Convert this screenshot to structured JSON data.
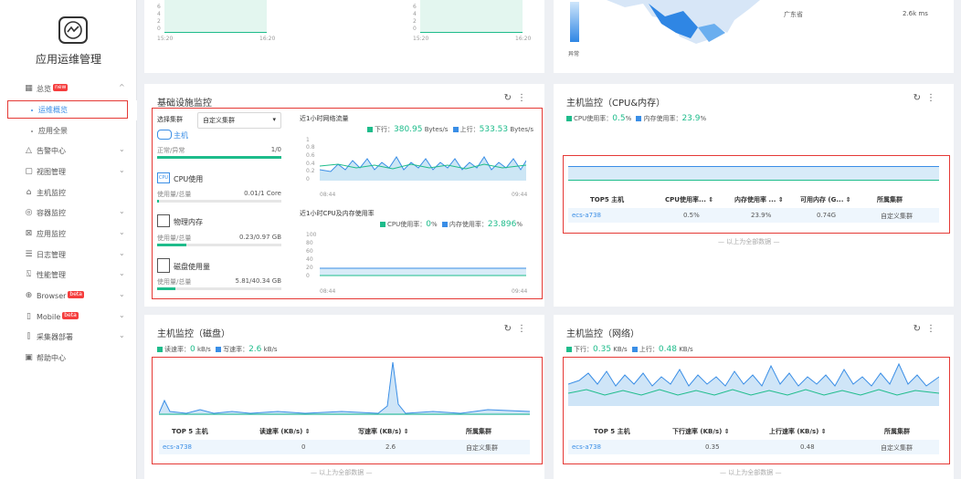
{
  "sidebar": {
    "app_title": "应用运维管理",
    "items": [
      {
        "label": "总览",
        "badge": "new",
        "icon": "grid-icon",
        "chevron": "^"
      },
      {
        "label": "运维概览",
        "sub": true,
        "active": true
      },
      {
        "label": "应用全景",
        "sub": true
      },
      {
        "label": "告警中心",
        "icon": "bell-icon",
        "chevron": "v"
      },
      {
        "label": "视图管理",
        "icon": "window-icon",
        "chevron": "v"
      },
      {
        "label": "主机监控",
        "icon": "host-icon"
      },
      {
        "label": "容器监控",
        "icon": "container-icon",
        "chevron": "v"
      },
      {
        "label": "应用监控",
        "icon": "app-monitor-icon",
        "chevron": "v"
      },
      {
        "label": "日志管理",
        "icon": "log-icon",
        "chevron": "v"
      },
      {
        "label": "性能管理",
        "icon": "performance-icon",
        "chevron": "v"
      },
      {
        "label": "Browser",
        "badge": "beta",
        "icon": "globe-icon",
        "chevron": "v"
      },
      {
        "label": "Mobile",
        "badge": "beta",
        "icon": "mobile-icon",
        "chevron": "v"
      },
      {
        "label": "采集器部署",
        "icon": "collector-icon",
        "chevron": "v"
      },
      {
        "label": "帮助中心",
        "icon": "help-icon"
      }
    ]
  },
  "top_cards": {
    "left": {
      "ticks": [
        "6",
        "4",
        "2",
        "0"
      ],
      "x_start": "15:20",
      "x_end": "16:20"
    },
    "mid": {
      "ticks": [
        "6",
        "4",
        "2",
        "0"
      ],
      "x_start": "15:20",
      "x_end": "16:20"
    },
    "right": {
      "region": "广东省",
      "value": "2.6k ms",
      "legend_low": "异常"
    }
  },
  "infra": {
    "title": "基础设施监控",
    "refresh_icon": "refresh-icon",
    "more_icon": "more-icon",
    "select_label": "选择集群",
    "select_value": "自定义集群",
    "host": {
      "name": "主机",
      "sub": "正常/异常",
      "value_a": "1",
      "value_b": "/0",
      "fill": 1.0
    },
    "cpu": {
      "name": "CPU使用",
      "sub": "使用量/总量",
      "value_a": "0.01",
      "value_b": "/1 Core",
      "fill": 0.01
    },
    "mem": {
      "name": "物理内存",
      "sub": "使用量/总量",
      "value_a": "0.23",
      "value_b": "/0.97 GB",
      "fill": 0.237
    },
    "disk": {
      "name": "磁盘使用量",
      "sub": "使用量/总量",
      "value_a": "5.81",
      "value_b": "/40.34 GB",
      "fill": 0.144
    },
    "net_chart": {
      "title": "近1小时网络流量",
      "down_label": "下行：",
      "down_value": "380.95",
      "down_unit": "Bytes/s",
      "up_label": "上行：",
      "up_value": "533.53",
      "up_unit": "Bytes/s",
      "ticks": [
        "1",
        "0.8",
        "0.6",
        "0.4",
        "0.2",
        "0"
      ],
      "x_start": "08:44",
      "x_end": "09:44"
    },
    "cpu_chart": {
      "title": "近1小时CPU及内存使用率",
      "cpu_label": "CPU使用率：",
      "cpu_value": "0",
      "cpu_unit": "%",
      "mem_label": "内存使用率：",
      "mem_value": "23.896",
      "mem_unit": "%",
      "ticks": [
        "100",
        "80",
        "60",
        "40",
        "20",
        "0"
      ],
      "x_start": "08:44",
      "x_end": "09:44"
    }
  },
  "host_cpu": {
    "title": "主机监控（CPU&内存）",
    "cpu_label": "CPU使用率：",
    "cpu_value": "0.5",
    "cpu_unit": "%",
    "mem_label": "内存使用率：",
    "mem_value": "23.9",
    "mem_unit": "%",
    "headers": [
      "TOP5 主机",
      "CPU使用率... ⇕",
      "内存使用率 ... ⇕",
      "可用内存 (G... ⇕",
      "所属集群"
    ],
    "rows": [
      [
        "ecs-a738",
        "0.5%",
        "23.9%",
        "0.74G",
        "自定义集群"
      ]
    ],
    "footnote": "— 以上为全部数据 —"
  },
  "host_disk": {
    "title": "主机监控（磁盘）",
    "read_label": "读速率：",
    "read_value": "0",
    "read_unit": "kB/s",
    "write_label": "写速率：",
    "write_value": "2.6",
    "write_unit": "kB/s",
    "headers": [
      "TOP 5 主机",
      "读速率 (KB/s)  ⇕",
      "写速率 (KB/s)  ⇕",
      "所属集群"
    ],
    "rows": [
      [
        "ecs-a738",
        "0",
        "2.6",
        "自定义集群"
      ]
    ],
    "footnote": "— 以上为全部数据 —"
  },
  "host_net": {
    "title": "主机监控（网络）",
    "down_label": "下行：",
    "down_value": "0.35",
    "down_unit": "KB/s",
    "up_label": "上行：",
    "up_value": "0.48",
    "up_unit": "KB/s",
    "headers": [
      "TOP 5 主机",
      "下行速率 (KB/s)  ⇕",
      "上行速率 (KB/s)  ⇕",
      "所属集群"
    ],
    "rows": [
      [
        "ecs-a738",
        "0.35",
        "0.48",
        "自定义集群"
      ]
    ],
    "footnote": "— 以上为全部数据 —"
  },
  "colors": {
    "green": "#1ebc8b",
    "blue": "#3a8ee6",
    "red_box": "#e53935"
  }
}
